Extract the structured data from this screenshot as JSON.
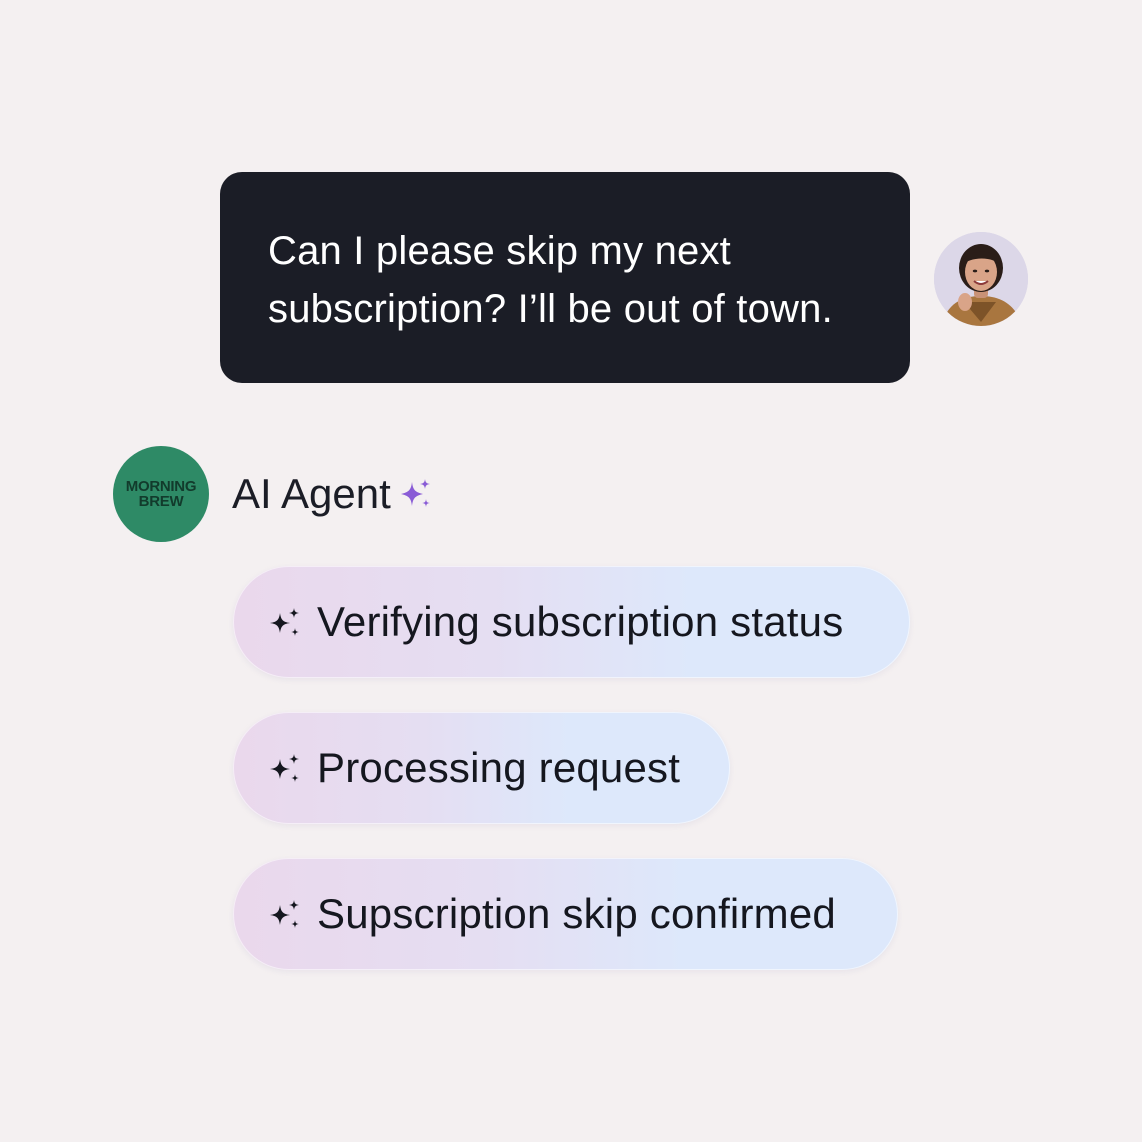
{
  "user_message": {
    "text": "Can I please skip my next\nsubscription? I’ll be out of town."
  },
  "agent": {
    "name": "AI Agent",
    "brand_logo_lines": [
      "MORNING",
      "BREW"
    ],
    "icon": "sparkle-icon",
    "accent_color": "#8a5cd6"
  },
  "steps": [
    {
      "label": "Verifying subscription status",
      "icon": "sparkle-icon"
    },
    {
      "label": "Processing request",
      "icon": "sparkle-icon"
    },
    {
      "label": "Supscription skip confirmed",
      "icon": "sparkle-icon"
    }
  ],
  "colors": {
    "background": "#f4f0f1",
    "user_bubble": "#1b1d26",
    "brand_green": "#2e8a66"
  }
}
